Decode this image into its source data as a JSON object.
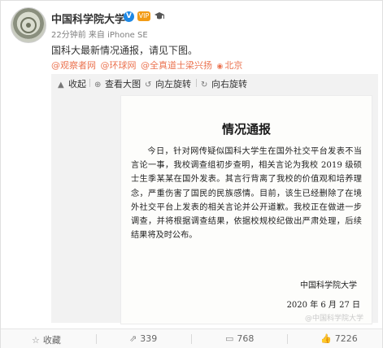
{
  "post": {
    "username": "中国科学院大学",
    "verified_mark": "V",
    "vip_badge": "VIP",
    "meta": "22分钟前 来自 iPhone SE",
    "text": "国科大最新情况通报，请见下图。",
    "tags": [
      "@观察者网",
      "@环球网",
      "@全真道士梁兴扬"
    ],
    "location": "北京"
  },
  "toolbar": {
    "collapse": "收起",
    "view_large": "查看大图",
    "rotate_left": "向左旋转",
    "rotate_right": "向右旋转"
  },
  "document": {
    "title": "情况通报",
    "body": "今日，针对网传疑似国科大学生在国外社交平台发表不当言论一事，我校调查组初步查明，相关言论为我校 2019 级硕士生季某某在国外发表。其言行背离了我校的价值观和培养理念，严重伤害了国民的民族感情。目前，该生已经删除了在境外社交平台上发表的相关言论并公开道歉。我校正在做进一步调查，并将根据调查结果，依据校规校纪做出严肃处理，后续结果将及时公布。",
    "signature": "中国科学院大学",
    "date": "2020 年 6 月 27 日",
    "watermark": "@中国科学院大学"
  },
  "footer": {
    "favorite": "收藏",
    "share_count": "339",
    "comment_count": "768",
    "like_count": "7226"
  },
  "colors": {
    "accent": "#eb7350",
    "verified": "#1e88e5"
  }
}
